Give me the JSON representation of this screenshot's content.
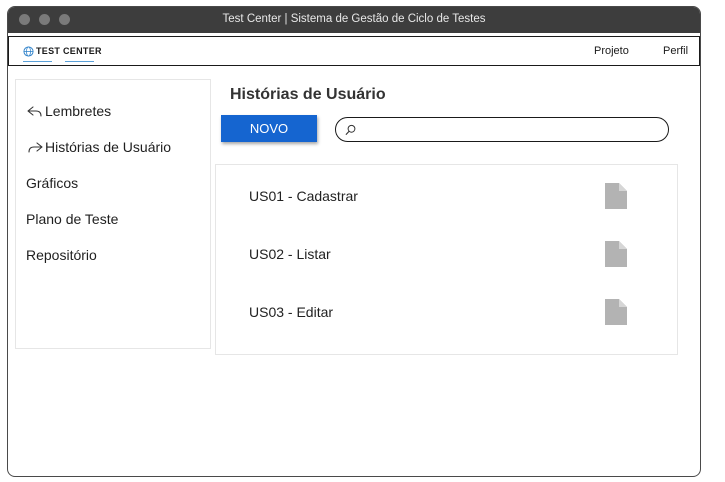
{
  "window": {
    "title": "Test Center | Sistema de Gestão de Ciclo de Testes"
  },
  "navbar": {
    "logo_text": "TEST CENTER",
    "links": [
      {
        "label": "Projeto"
      },
      {
        "label": "Perfil"
      }
    ]
  },
  "sidebar": {
    "items": [
      {
        "label": "Lembretes",
        "icon": "reply-arrow-icon"
      },
      {
        "label": "Histórias de Usuário",
        "icon": "forward-arrow-icon"
      },
      {
        "label": "Gráficos"
      },
      {
        "label": "Plano de Teste"
      },
      {
        "label": "Repositório"
      }
    ]
  },
  "main": {
    "title": "Histórias de Usuário",
    "new_button": "NOVO",
    "search": {
      "placeholder": "",
      "value": ""
    },
    "stories": [
      {
        "label": "US01 - Cadastrar",
        "icon": "document-icon"
      },
      {
        "label": "US02 - Listar",
        "icon": "document-icon"
      },
      {
        "label": "US03 - Editar",
        "icon": "document-icon"
      }
    ]
  },
  "colors": {
    "accent": "#1565d0",
    "titlebar": "#3d3d3d",
    "doc_icon": "#b3b3b3"
  }
}
